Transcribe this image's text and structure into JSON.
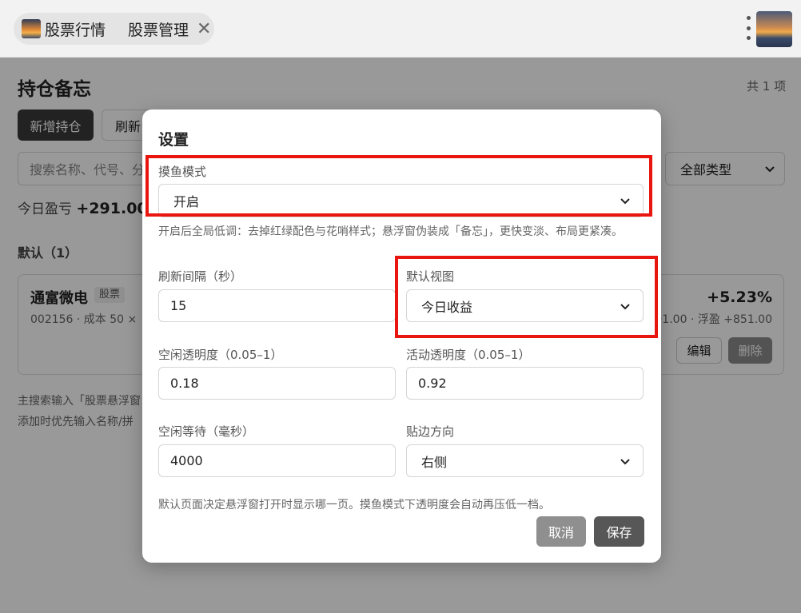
{
  "tabs": [
    {
      "label": "股票行情"
    },
    {
      "label": "股票管理",
      "close": "✕"
    }
  ],
  "page": {
    "title": "持仓备忘",
    "count": "共 1 项",
    "add_button": "新增持仓",
    "refresh_button": "刷新",
    "search_placeholder": "搜索名称、代号、分",
    "type_filter": "全部类型",
    "pnl_label": "今日盈亏",
    "pnl_value": "+291.00",
    "group_label": "默认（1）",
    "card": {
      "name": "通富微电",
      "tag": "股票",
      "meta": "002156 · 成本 50 ×",
      "pct": "+5.23%",
      "meta_right": "291.00 · 浮盈 +851.00",
      "edit": "编辑",
      "delete": "删除"
    },
    "hint1": "主搜索输入「股票悬浮窗",
    "hint2": "添加时优先输入名称/拼"
  },
  "modal": {
    "title": "设置",
    "slack_mode_label": "摸鱼模式",
    "slack_mode_value": "开启",
    "slack_mode_desc": "开启后全局低调：去掉红绿配色与花哨样式；悬浮窗伪装成「备忘」，更快变淡、布局更紧凑。",
    "refresh_label": "刷新间隔（秒）",
    "refresh_value": "15",
    "default_view_label": "默认视图",
    "default_view_value": "今日收益",
    "idle_opacity_label": "空闲透明度（0.05–1）",
    "idle_opacity_value": "0.18",
    "active_opacity_label": "活动透明度（0.05–1）",
    "active_opacity_value": "0.92",
    "idle_wait_label": "空闲等待（毫秒）",
    "idle_wait_value": "4000",
    "dock_label": "贴边方向",
    "dock_value": "右侧",
    "footer_desc": "默认页面决定悬浮窗打开时显示哪一页。摸鱼模式下透明度会自动再压低一档。",
    "cancel": "取消",
    "save": "保存"
  },
  "colors": {
    "highlight": "#e8160e",
    "overlay": "rgba(0,0,0,0.40)",
    "primary_button": "#3a3a3a"
  }
}
